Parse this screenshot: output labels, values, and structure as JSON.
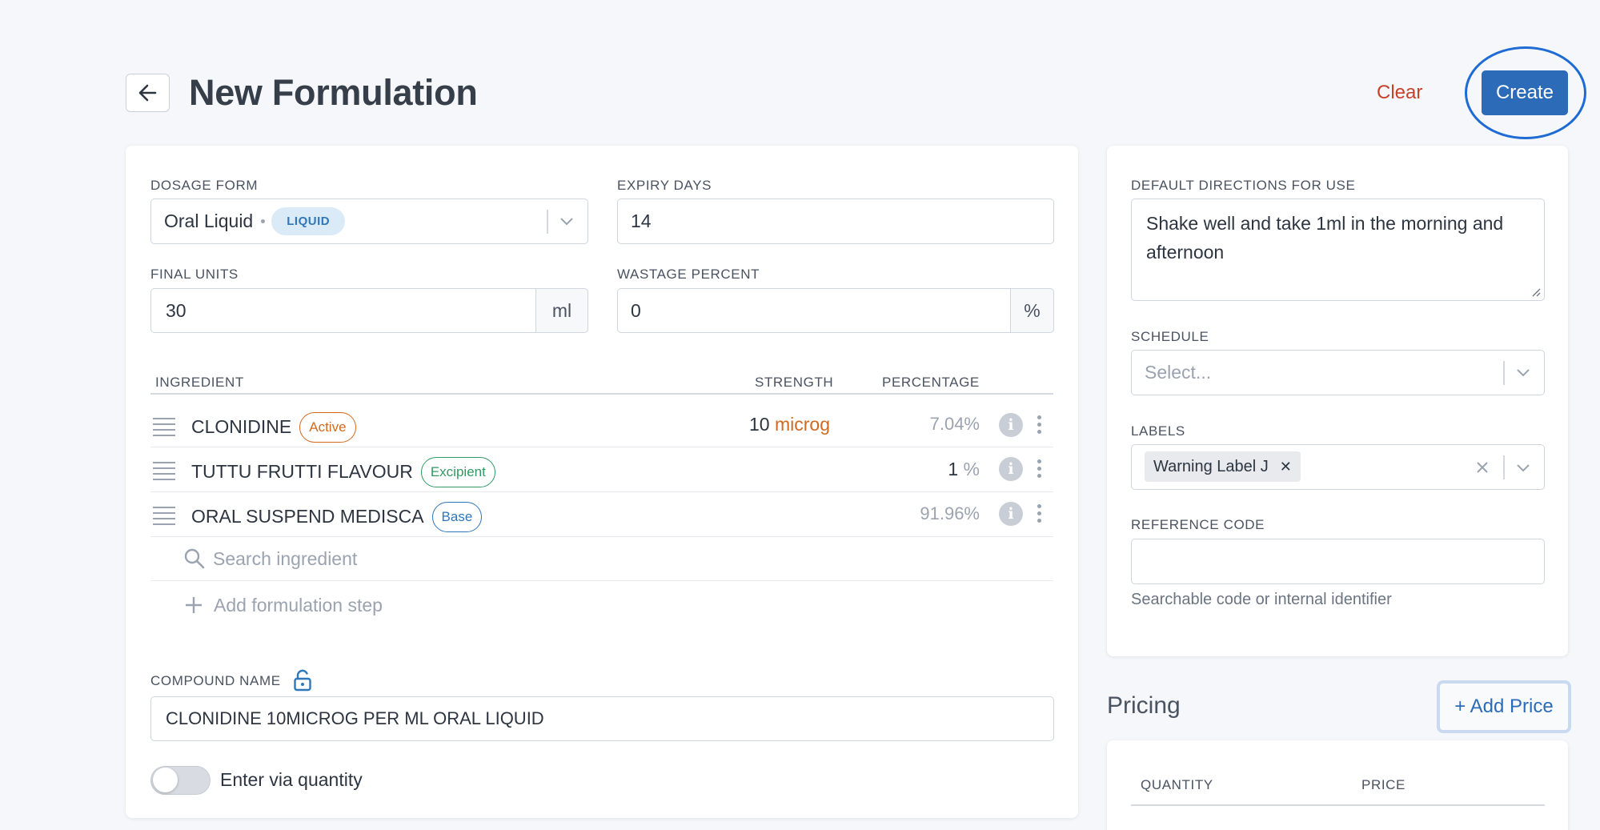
{
  "header": {
    "title": "New Formulation",
    "clear_label": "Clear",
    "create_label": "Create"
  },
  "formulation": {
    "dosage_form": {
      "label": "DOSAGE FORM",
      "value": "Oral Liquid",
      "badge": "LIQUID"
    },
    "expiry_days": {
      "label": "EXPIRY DAYS",
      "value": "14"
    },
    "final_units": {
      "label": "FINAL UNITS",
      "value": "30",
      "unit": "ml"
    },
    "wastage_percent": {
      "label": "WASTAGE PERCENT",
      "value": "0",
      "unit": "%"
    }
  },
  "ingredients": {
    "columns": {
      "ingredient": "INGREDIENT",
      "strength": "STRENGTH",
      "percentage": "PERCENTAGE"
    },
    "rows": [
      {
        "name": "CLONIDINE",
        "tag": "Active",
        "strength": "10",
        "unit": "microg",
        "percentage": "7.04%"
      },
      {
        "name": "TUTTU FRUTTI FLAVOUR",
        "tag": "Excipient",
        "strength": "1",
        "unit": "%",
        "percentage": ""
      },
      {
        "name": "ORAL SUSPEND MEDISCA",
        "tag": "Base",
        "strength": "",
        "unit": "",
        "percentage": "91.96%"
      }
    ],
    "search_placeholder": "Search ingredient",
    "add_step_label": "Add formulation step"
  },
  "compound": {
    "label": "COMPOUND NAME",
    "value": "CLONIDINE 10MICROG PER ML ORAL LIQUID",
    "toggle_label": "Enter via quantity",
    "toggle_on": false
  },
  "details": {
    "directions": {
      "label": "DEFAULT DIRECTIONS FOR USE",
      "value": "Shake well and take 1ml in the morning and afternoon"
    },
    "schedule": {
      "label": "SCHEDULE",
      "placeholder": "Select..."
    },
    "labels": {
      "label": "LABELS",
      "chip": "Warning Label J"
    },
    "reference_code": {
      "label": "REFERENCE CODE",
      "value": "",
      "helper": "Searchable code or internal identifier"
    }
  },
  "pricing": {
    "title": "Pricing",
    "add_price_label": "+ Add Price",
    "columns": {
      "quantity": "QUANTITY",
      "price": "PRICE"
    }
  },
  "colors": {
    "primary": "#2c6bb8",
    "danger": "#c8412b",
    "active_tag": "#d06a20",
    "excipient_tag": "#2f9a63",
    "base_tag": "#2f77b8",
    "highlight_ring": "#1f6bd4"
  }
}
